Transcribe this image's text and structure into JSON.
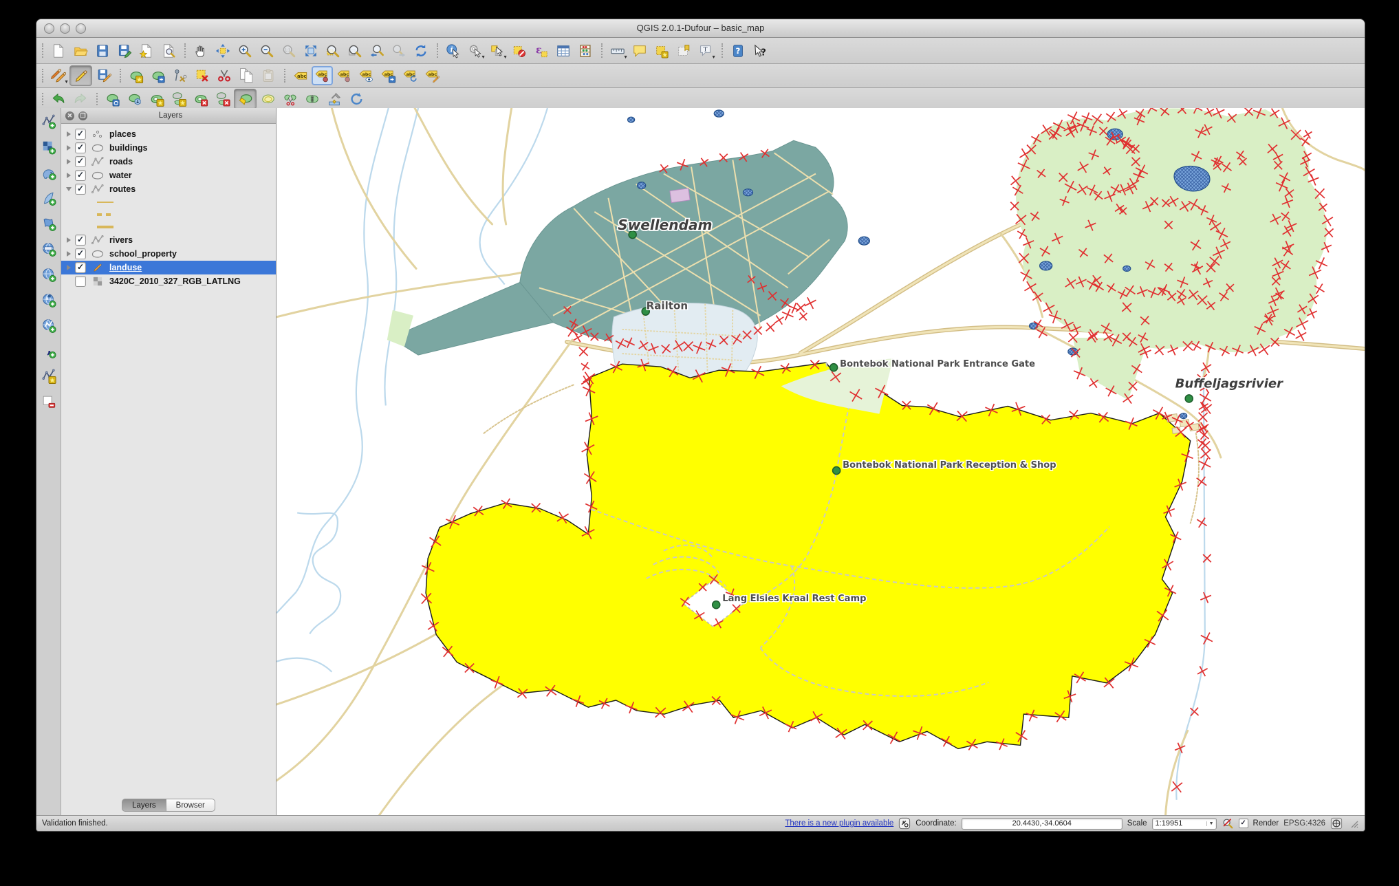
{
  "window": {
    "title": "QGIS 2.0.1-Dufour – basic_map"
  },
  "toolbars": {
    "row1": [
      [
        {
          "name": "new-project"
        },
        {
          "name": "open-project"
        },
        {
          "name": "save-project"
        },
        {
          "name": "save-project-as"
        },
        {
          "name": "new-composer"
        },
        {
          "name": "composer-manager"
        }
      ],
      [
        {
          "name": "pan"
        },
        {
          "name": "pan-to-selection"
        },
        {
          "name": "zoom-in"
        },
        {
          "name": "zoom-out"
        },
        {
          "name": "zoom-native",
          "disabled": true
        },
        {
          "name": "zoom-full"
        },
        {
          "name": "zoom-to-selection"
        },
        {
          "name": "zoom-to-layer"
        },
        {
          "name": "zoom-last"
        },
        {
          "name": "zoom-next",
          "disabled": true
        },
        {
          "name": "refresh"
        }
      ],
      [
        {
          "name": "identify-features"
        },
        {
          "name": "run-feature-action",
          "dd": true
        },
        {
          "name": "select-features",
          "dd": true
        },
        {
          "name": "deselect-features"
        },
        {
          "name": "select-by-expression"
        },
        {
          "name": "open-attribute-table"
        },
        {
          "name": "field-calculator"
        }
      ],
      [
        {
          "name": "measure",
          "dd": true
        },
        {
          "name": "map-tips"
        },
        {
          "name": "new-bookmark"
        },
        {
          "name": "show-bookmarks"
        },
        {
          "name": "text-annotation",
          "dd": true
        }
      ],
      [
        {
          "name": "help-contents"
        },
        {
          "name": "whats-this"
        }
      ]
    ],
    "row2": [
      [
        {
          "name": "current-edits",
          "dd": true
        },
        {
          "name": "toggle-editing",
          "pressed": true
        },
        {
          "name": "save-layer-edits"
        }
      ],
      [
        {
          "name": "add-feature"
        },
        {
          "name": "move-feature"
        },
        {
          "name": "node-tool"
        },
        {
          "name": "delete-selected"
        },
        {
          "name": "cut-features"
        },
        {
          "name": "copy-features"
        },
        {
          "name": "paste-features",
          "disabled": true
        }
      ],
      [
        {
          "name": "labeling"
        },
        {
          "name": "pin-labels",
          "framed": true
        },
        {
          "name": "unpin-labels"
        },
        {
          "name": "show-hide-labels"
        },
        {
          "name": "move-label"
        },
        {
          "name": "rotate-label"
        },
        {
          "name": "change-label-properties"
        }
      ]
    ],
    "row3": [
      [
        {
          "name": "undo"
        },
        {
          "name": "redo",
          "disabled": true
        }
      ],
      [
        {
          "name": "rotate-feature"
        },
        {
          "name": "simplify-feature"
        },
        {
          "name": "add-ring"
        },
        {
          "name": "add-part"
        },
        {
          "name": "delete-ring"
        },
        {
          "name": "delete-part"
        },
        {
          "name": "reshape-features",
          "pressed": true
        },
        {
          "name": "offset-curve"
        },
        {
          "name": "split-features"
        },
        {
          "name": "merge-features"
        },
        {
          "name": "merge-attributes"
        },
        {
          "name": "rotate-point-symbols"
        }
      ]
    ],
    "left": [
      [
        {
          "name": "add-vector-layer"
        },
        {
          "name": "add-raster-layer"
        },
        {
          "name": "add-postgis-layer"
        },
        {
          "name": "add-spatialite-layer"
        },
        {
          "name": "add-mssql-layer"
        },
        {
          "name": "add-oracle-layer"
        },
        {
          "name": "add-wms-layer"
        },
        {
          "name": "add-wcs-layer"
        },
        {
          "name": "add-wfs-layer"
        },
        {
          "name": "add-delimited-text-layer"
        },
        {
          "name": "new-shapefile-layer"
        },
        {
          "name": "remove-layer"
        }
      ]
    ]
  },
  "layers_panel": {
    "title": "Layers",
    "close_glyph": "✕",
    "float_glyph": "❐",
    "checkmark": "✓",
    "rows": [
      {
        "label": "places",
        "type": "point",
        "checked": true,
        "expander": "right"
      },
      {
        "label": "buildings",
        "type": "polygon",
        "checked": true,
        "expander": "right"
      },
      {
        "label": "roads",
        "type": "line",
        "checked": true,
        "expander": "right"
      },
      {
        "label": "water",
        "type": "polygon",
        "checked": true,
        "expander": "right"
      },
      {
        "label": "routes",
        "type": "line",
        "checked": true,
        "expander": "down"
      },
      {
        "swatch": "solid"
      },
      {
        "swatch": "dash"
      },
      {
        "swatch": "thick"
      },
      {
        "label": "rivers",
        "type": "line",
        "checked": true,
        "expander": "right"
      },
      {
        "label": "school_property",
        "type": "polygon",
        "checked": true,
        "expander": "right"
      },
      {
        "label": "landuse",
        "type": "pencil",
        "checked": true,
        "expander": "right",
        "selected": true
      },
      {
        "label": "3420C_2010_327_RGB_LATLNG",
        "type": "raster",
        "checked": false,
        "expander": "none"
      }
    ],
    "tabs": [
      {
        "label": "Layers",
        "active": true
      },
      {
        "label": "Browser",
        "active": false
      }
    ]
  },
  "map": {
    "labels": [
      {
        "text": "Swellendam"
      },
      {
        "text": "Railton"
      },
      {
        "text": "Bontebok National Park Entrance Gate"
      },
      {
        "text": "Bontebok National Park Reception & Shop"
      },
      {
        "text": "Lang Elsies Kraal Rest Camp"
      },
      {
        "text": "Buffeljagsrivier"
      }
    ]
  },
  "status_bar": {
    "message": "Validation finished.",
    "plugin_link": "There is a new plugin available",
    "coordinate_label": "Coordinate:",
    "coordinate_value": "20.4430,-34.0604",
    "scale_label": "Scale",
    "scale_value": "1:19951",
    "render_label": "Render",
    "render_check": "✓",
    "crs": "EPSG:4326"
  },
  "colors": {
    "selection": "#3b77d8",
    "landuse_yellow": "#ffff00",
    "park_green": "#d9efc5",
    "park_pale": "#e6f3d8",
    "town_teal": "#7ba7a2",
    "road_tan": "#e5d7a3",
    "road_casing": "#d2bd85",
    "road_fill": "#f0e4b8",
    "river_blue": "#bcd9ec",
    "water_fill": "#7aa6dc",
    "vertex_red": "#e03030"
  }
}
